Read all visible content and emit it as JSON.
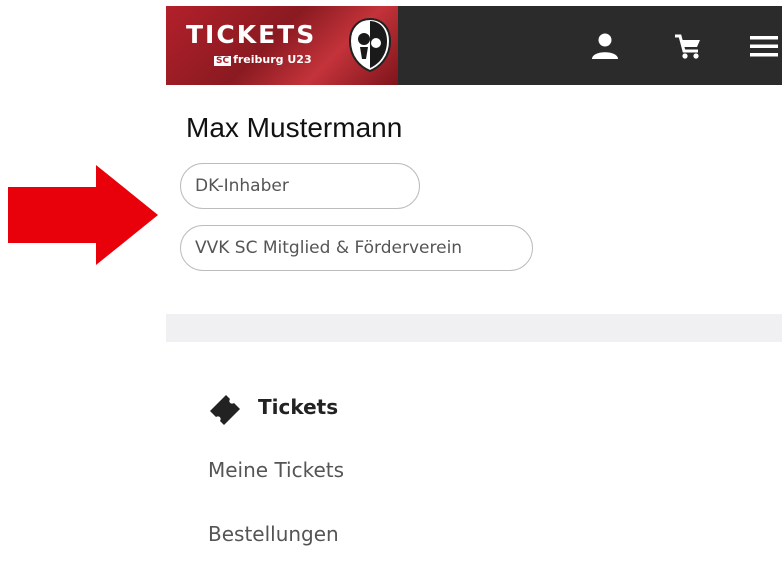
{
  "annotation": {
    "arrow_color": "#e8000b"
  },
  "header": {
    "logo_title": "TICKETS",
    "logo_sc": "SC",
    "logo_subtitle": "freiburg U23",
    "bar_color": "#2b2b2b",
    "brand_red": "#b3202a",
    "icons": [
      "user-icon",
      "shopping-cart-icon",
      "hamburger-menu-icon"
    ]
  },
  "profile": {
    "name": "Max Mustermann",
    "badges": [
      "DK-Inhaber",
      "VVK SC Mitglied & Förderverein"
    ]
  },
  "section": {
    "icon": "ticket-icon",
    "title": "Tickets",
    "links": [
      "Meine Tickets",
      "Bestellungen"
    ]
  }
}
